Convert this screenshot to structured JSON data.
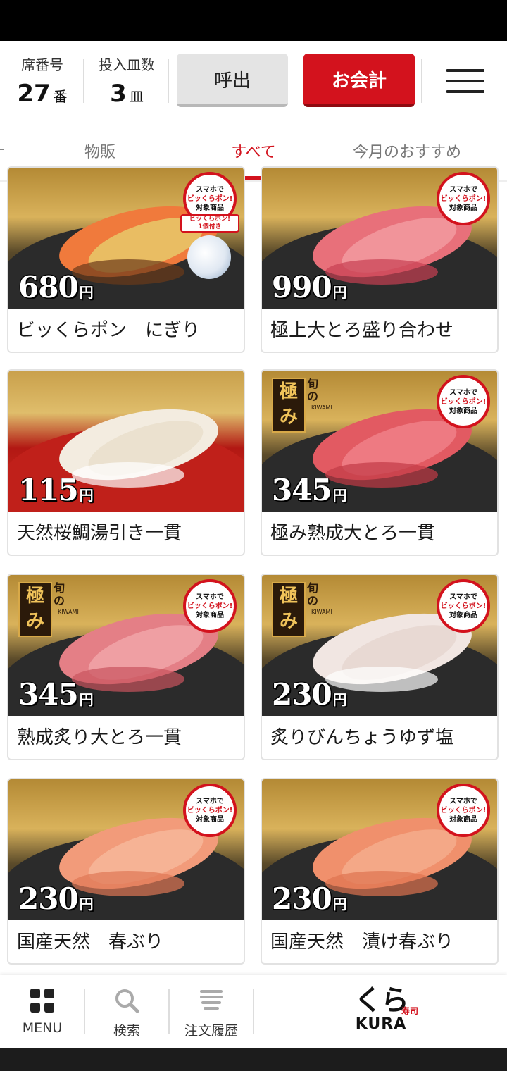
{
  "header": {
    "seat_label": "席番号",
    "seat_number": "27",
    "seat_unit": "番",
    "plates_label": "投入皿数",
    "plates_count": "3",
    "plates_unit": "皿",
    "call_label": "呼出",
    "checkout_label": "お会計"
  },
  "tabs": [
    {
      "label": "物販",
      "active": false
    },
    {
      "label": "すべて",
      "active": true
    },
    {
      "label": "今月のおすすめ",
      "active": false
    }
  ],
  "badge": {
    "line1": "スマホで",
    "line2": "ビッくらポン!",
    "line3": "対象商品"
  },
  "kiwami": {
    "kanji": "極み",
    "side": "旬の",
    "roman": "KIWAMI"
  },
  "products": [
    {
      "price": "680",
      "yen": "円",
      "name": "ビッくらポン　にぎり",
      "badge": true,
      "kiwami": false,
      "sticker": true,
      "sticker_line1": "ビッくらポン!",
      "sticker_line2": "1個付き"
    },
    {
      "price": "990",
      "yen": "円",
      "name": "極上大とろ盛り合わせ",
      "badge": true,
      "kiwami": false
    },
    {
      "price": "115",
      "yen": "円",
      "name": "天然桜鯛湯引き一貫",
      "badge": false,
      "kiwami": false
    },
    {
      "price": "345",
      "yen": "円",
      "name": "極み熟成大とろ一貫",
      "badge": true,
      "kiwami": true
    },
    {
      "price": "345",
      "yen": "円",
      "name": "熟成炙り大とろ一貫",
      "badge": true,
      "kiwami": true
    },
    {
      "price": "230",
      "yen": "円",
      "name": "炙りびんちょうゆず塩",
      "badge": true,
      "kiwami": true
    },
    {
      "price": "230",
      "yen": "円",
      "name": "国産天然　春ぶり",
      "badge": true,
      "kiwami": false
    },
    {
      "price": "230",
      "yen": "円",
      "name": "国産天然　漬け春ぶり",
      "badge": true,
      "kiwami": false
    }
  ],
  "bottom_nav": {
    "menu_label": "MENU",
    "search_label": "検索",
    "history_label": "注文履歴",
    "logo_text": "くら",
    "logo_sub": "KURA",
    "logo_stamp": "寿司"
  },
  "colors": {
    "accent": "#d3121d"
  }
}
